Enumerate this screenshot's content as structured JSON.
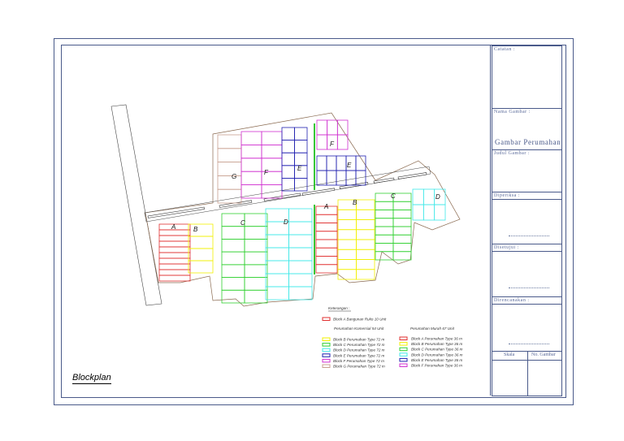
{
  "title_block": {
    "catatan": "Catatan :",
    "nama_gambar": "Nama Gambar :",
    "nama_value": "Gambar Perumahan",
    "judul_gambar": "Judul Gambar :",
    "diperiksa": "Diperiksa :",
    "disetujui": "Disetujui :",
    "direncanakan": "Direncanakan :",
    "skala": "Skala",
    "no_gambar": "No. Gambar"
  },
  "drawing_label": "Blockplan",
  "block_labels": {
    "upper": [
      "G",
      "F",
      "E",
      "F",
      "E"
    ],
    "lower": [
      "A",
      "B",
      "C",
      "D",
      "A",
      "B",
      "C",
      "D"
    ]
  },
  "legend": {
    "title": "Keterangan :",
    "ruko": {
      "label": "Block A Bangunan Ruko 10 Unit",
      "color": "#e03030"
    },
    "komersial_title": "Perumahan Komersial  54 Unit",
    "murah_title": "Perumahan Murah 67 Unit",
    "komersial": [
      {
        "label": "Block B Perumahan Type 72 m",
        "color": "#f2f000"
      },
      {
        "label": "Block C Perumahan Type 72 m",
        "color": "#30d030"
      },
      {
        "label": "Block D Perumahan Type 72 m",
        "color": "#40e8e8"
      },
      {
        "label": "Block E Perumahan Type 72 m",
        "color": "#2020b0"
      },
      {
        "label": "Block F Perumahan Type 72 m",
        "color": "#d030d0"
      },
      {
        "label": "Block G Perumahan Type 72 m",
        "color": "#c8a090"
      }
    ],
    "murah": [
      {
        "label": "Block A Perumahan Type 36 m",
        "color": "#e03030"
      },
      {
        "label": "Block B Perumahan Type 36 m",
        "color": "#f2f000"
      },
      {
        "label": "Block C Perumahan Type 36 m",
        "color": "#30d030"
      },
      {
        "label": "Block D Perumahan Type 36 m",
        "color": "#40e8e8"
      },
      {
        "label": "Block E Perumahan Type 36 m",
        "color": "#2020b0"
      },
      {
        "label": "Block F Perumahan Type 36 m",
        "color": "#d030d0"
      }
    ]
  }
}
